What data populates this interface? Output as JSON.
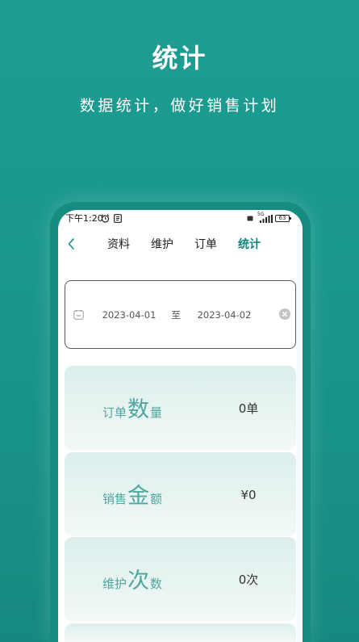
{
  "header": {
    "title": "统计",
    "subtitle": "数据统计，做好销售计划"
  },
  "status_bar": {
    "time": "下午1:20",
    "network": "5G",
    "battery": "63",
    "icons": [
      "alarm-icon",
      "notification-icon",
      "hd-icon",
      "signal-icon",
      "battery-icon"
    ]
  },
  "nav": {
    "back_icon": "chevron-left-icon",
    "tabs": [
      {
        "label": "资料",
        "active": false
      },
      {
        "label": "维护",
        "active": false
      },
      {
        "label": "订单",
        "active": false
      },
      {
        "label": "统计",
        "active": true
      }
    ]
  },
  "date_range": {
    "icon": "calendar-icon",
    "start": "2023-04-01",
    "separator": "至",
    "end": "2023-04-02",
    "clear_icon": "clear-icon"
  },
  "stats": [
    {
      "prefix": "订单",
      "emphasis": "数",
      "suffix": "量",
      "value": "0单"
    },
    {
      "prefix": "销售",
      "emphasis": "金",
      "suffix": "额",
      "value": "¥0"
    },
    {
      "prefix": "维护",
      "emphasis": "次",
      "suffix": "数",
      "value": "0次"
    }
  ],
  "colors": {
    "background": "#1a968b",
    "phone_frame": "#168b80",
    "accent": "#138277",
    "stat_label": "#4fa69e",
    "stat_value": "#333333",
    "card_tint": "#dcefec"
  }
}
